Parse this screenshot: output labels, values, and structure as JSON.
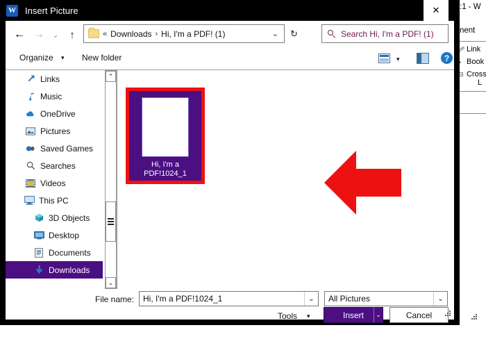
{
  "background_window": {
    "title_fragment": ":1  -  W",
    "ribbon_tab_fragment": "nent",
    "group_items": [
      {
        "icon": "link-icon",
        "label": "Link"
      },
      {
        "icon": "bookmark-icon",
        "label": "Book"
      },
      {
        "icon": "cross-reference-icon",
        "label": "Cross"
      }
    ],
    "group_label_fragment": "L"
  },
  "dialog": {
    "title": "Insert Picture",
    "icon": "word-icon",
    "icon_letter": "W",
    "close_label": "✕",
    "nav": {
      "back_icon": "back-arrow-icon",
      "back_glyph": "←",
      "forward_icon": "forward-arrow-icon",
      "forward_glyph": "→",
      "recent_icon": "recent-locations-chevron-icon",
      "recent_glyph": "⌄",
      "up_icon": "up-arrow-icon",
      "up_glyph": "↑"
    },
    "address_bar": {
      "folder_icon": "folder-icon",
      "overflow_glyph": "«",
      "separator_glyph": "›",
      "crumbs": [
        "Downloads",
        "Hi, I'm a PDF! (1)"
      ],
      "chevron_glyph": "⌄",
      "refresh_icon": "refresh-icon",
      "refresh_glyph": "↻"
    },
    "search": {
      "icon": "search-icon",
      "placeholder": "Search Hi, I'm a PDF! (1)",
      "text_color": "#6a1b4d"
    },
    "toolbar": {
      "organize_label": "Organize",
      "organize_caret": "▾",
      "new_folder_label": "New folder",
      "view_icon": "view-layout-icon",
      "view_caret": "▾",
      "preview_pane_icon": "preview-pane-icon",
      "help_icon": "help-icon",
      "help_glyph": "?"
    },
    "nav_pane": {
      "items": [
        {
          "label": "Links",
          "icon": "links-icon",
          "indent": "indent1",
          "selected": false
        },
        {
          "label": "Music",
          "icon": "music-icon",
          "indent": "indent1",
          "selected": false
        },
        {
          "label": "OneDrive",
          "icon": "onedrive-icon",
          "indent": "indent1",
          "selected": false
        },
        {
          "label": "Pictures",
          "icon": "pictures-icon",
          "indent": "indent1",
          "selected": false
        },
        {
          "label": "Saved Games",
          "icon": "saved-games-icon",
          "indent": "indent1",
          "selected": false
        },
        {
          "label": "Searches",
          "icon": "searches-icon",
          "indent": "indent1",
          "selected": false
        },
        {
          "label": "Videos",
          "icon": "videos-icon",
          "indent": "indent1",
          "selected": false
        },
        {
          "label": "This PC",
          "icon": "this-pc-icon",
          "indent": "root",
          "selected": false
        },
        {
          "label": "3D Objects",
          "icon": "3d-objects-icon",
          "indent": "indent0",
          "selected": false
        },
        {
          "label": "Desktop",
          "icon": "desktop-icon",
          "indent": "indent0",
          "selected": false
        },
        {
          "label": "Documents",
          "icon": "documents-icon",
          "indent": "indent0",
          "selected": false
        },
        {
          "label": "Downloads",
          "icon": "downloads-icon",
          "indent": "indent0",
          "selected": true
        }
      ],
      "selection_color": "#4B0F82",
      "scrollbar": {
        "up_glyph": "⌃",
        "down_glyph": "⌄"
      }
    },
    "file_list": {
      "items": [
        {
          "name": "Hi, I'm a PDF!1024_1",
          "selected": true,
          "thumbnail": "blank-page-thumbnail"
        }
      ]
    },
    "annotation": {
      "arrow_icon": "red-arrow-left-icon",
      "arrow_color": "#EE1111",
      "highlight_box_color": "#EE1111"
    },
    "bottom": {
      "filename_label": "File name:",
      "filename_value": "Hi, I'm a PDF!1024_1",
      "filename_caret": "⌄",
      "filter_value": "All Pictures",
      "filter_caret": "⌄",
      "tools_label": "Tools",
      "tools_caret": "▾",
      "insert_label": "Insert",
      "insert_caret": "⌄",
      "cancel_label": "Cancel",
      "insert_color": "#4B0F82"
    }
  }
}
